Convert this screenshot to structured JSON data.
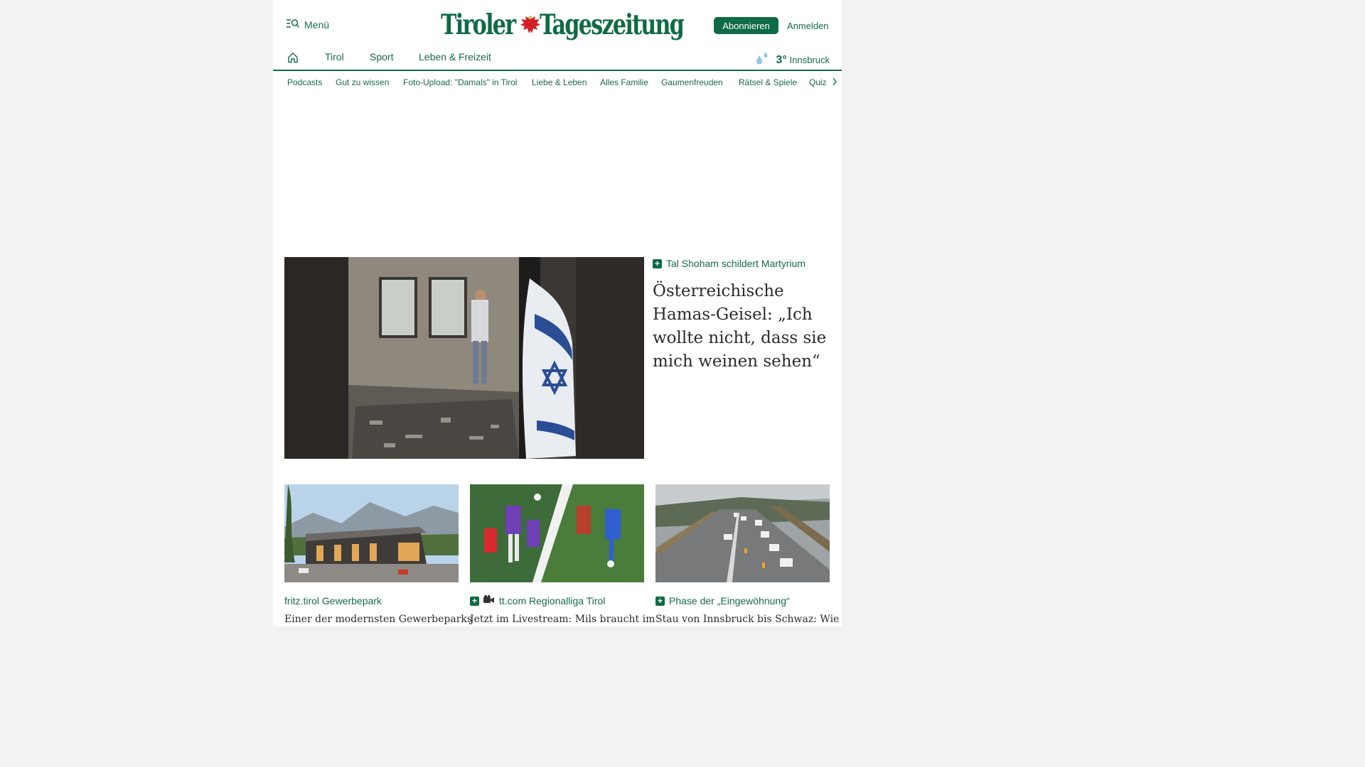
{
  "header": {
    "menu_label": "Menü",
    "logo_part1": "Tiroler",
    "logo_part2": "Tageszeitung",
    "subscribe_label": "Abonnieren",
    "login_label": "Anmelden"
  },
  "main_nav": {
    "home_icon": "home-icon",
    "items": [
      {
        "label": "Tirol"
      },
      {
        "label": "Sport"
      },
      {
        "label": "Leben & Freizeit"
      }
    ]
  },
  "weather": {
    "icon": "rain-icon",
    "temperature": "3°",
    "city": "Innsbruck"
  },
  "sub_nav": {
    "items": [
      {
        "label": "Podcasts"
      },
      {
        "label": "Gut zu wissen"
      },
      {
        "label": "Foto-Upload: \"Damals\" in Tirol"
      },
      {
        "label": "Liebe & Leben"
      },
      {
        "label": "Alles Familie"
      },
      {
        "label": "Gaumenfreuden"
      },
      {
        "label": "Rätsel & Spiele"
      },
      {
        "label": "Quiz"
      }
    ],
    "more_icon": "chevron-right-icon"
  },
  "hero": {
    "kicker": "Tal Shoham schildert Martyrium",
    "title": "Österreichische Hamas-Geisel: „Ich wollte nicht, dass sie mich weinen sehen“",
    "premium": true
  },
  "cards": [
    {
      "kicker": "fritz.tirol Gewerbepark",
      "title": "Einer der modernsten Gewerbeparks",
      "premium": false,
      "video": false
    },
    {
      "kicker": "tt.com Regionalliga Tirol",
      "title": "Jetzt im Livestream: Mils braucht im",
      "premium": true,
      "video": true
    },
    {
      "kicker": "Phase der „Eingewöhnung“",
      "title": "Stau von Innsbruck bis Schwaz: Wie",
      "premium": true,
      "video": false
    }
  ],
  "colors": {
    "brand_green": "#0f6b45",
    "link_green": "#17694a",
    "background": "#f2f2f2"
  }
}
